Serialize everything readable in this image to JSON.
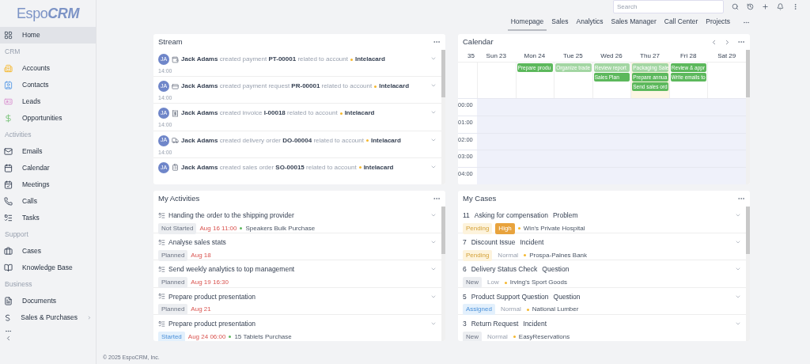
{
  "sidebar": {
    "logo": {
      "part_1": "Espo",
      "part_2": "CRM"
    },
    "groups": [
      {
        "items": [
          {
            "label": "Home",
            "selected": true,
            "expandable": false
          }
        ]
      },
      {
        "label": "CRM",
        "items": [
          {
            "label": "Accounts",
            "selected": false,
            "expandable": false
          },
          {
            "label": "Contacts",
            "selected": false,
            "expandable": false
          },
          {
            "label": "Leads",
            "selected": false,
            "expandable": false
          },
          {
            "label": "Opportunities",
            "selected": false,
            "expandable": false
          }
        ]
      },
      {
        "label": "Activities",
        "items": [
          {
            "label": "Emails",
            "selected": false,
            "expandable": false
          },
          {
            "label": "Calendar",
            "selected": false,
            "expandable": false
          },
          {
            "label": "Meetings",
            "selected": false,
            "expandable": false
          },
          {
            "label": "Calls",
            "selected": false,
            "expandable": false
          },
          {
            "label": "Tasks",
            "selected": false,
            "expandable": false
          }
        ]
      },
      {
        "label": "Support",
        "items": [
          {
            "label": "Cases",
            "selected": false,
            "expandable": false
          },
          {
            "label": "Knowledge Base",
            "selected": false,
            "expandable": false
          }
        ]
      },
      {
        "label": "Business",
        "items": [
          {
            "label": "Documents",
            "selected": false,
            "expandable": false
          },
          {
            "label": "Sales & Purchases",
            "selected": false,
            "expandable": true
          }
        ]
      }
    ]
  },
  "search": {
    "placeholder": "Search"
  },
  "dashboard_tabs": [
    {
      "label": "Homepage",
      "selected": true
    },
    {
      "label": "Sales",
      "selected": false
    },
    {
      "label": "Analytics",
      "selected": false
    },
    {
      "label": "Sales Manager",
      "selected": false
    },
    {
      "label": "Call Center",
      "selected": false
    },
    {
      "label": "Projects",
      "selected": false
    }
  ],
  "stream": {
    "title": "Stream",
    "items": [
      {
        "avatar": "JA",
        "text": "**Jack Adams** created payment **PT-00001** related to account",
        "account": {
          "label": "Intelacard",
          "color": "#f5b82e"
        },
        "time": "14:00"
      },
      {
        "avatar": "JA",
        "text": "**Jack Adams** created payment request **PR-00001** related to account",
        "account": {
          "label": "Intelacard",
          "color": "#f5b82e"
        },
        "time": "14:00"
      },
      {
        "avatar": "JA",
        "text": "**Jack Adams** created invoice **I-00018** related to account",
        "account": {
          "label": "Intelacard",
          "color": "#f5b82e"
        },
        "time": "14:00"
      },
      {
        "avatar": "JA",
        "text": "**Jack Adams** created delivery order **DO-00004** related to account",
        "account": {
          "label": "Intelacard",
          "color": "#f5b82e"
        },
        "time": "14:00"
      },
      {
        "avatar": "JA",
        "text": "**Jack Adams** created sales order **SO-00015** related to account",
        "account": {
          "label": "Intelacard",
          "color": "#f5b82e"
        }
      }
    ]
  },
  "calendar": {
    "title": "Calendar",
    "week_number": "35",
    "days": [
      {
        "label": "Sun 23",
        "today": false
      },
      {
        "label": "Mon 24",
        "today": false,
        "events": [
          {
            "title": "Prepare produ",
            "color": "#5cb85c"
          }
        ]
      },
      {
        "label": "Tue 25",
        "today": false,
        "events": [
          {
            "title": "Organize trade",
            "color": "#a3d6a3"
          }
        ]
      },
      {
        "label": "Wed 26",
        "today": false,
        "events": [
          {
            "title": "Review report",
            "color": "#a3d6a3"
          },
          {
            "title": "Sales Plan",
            "color": "#5cb85c"
          }
        ]
      },
      {
        "label": "Thu 27",
        "today": true,
        "events": [
          {
            "title": "Packaging Sale",
            "color": "#a3d6a3"
          },
          {
            "title": "Prepare annua",
            "color": "#5cb85c"
          },
          {
            "title": "Send sales ord",
            "color": "#5cb85c"
          }
        ]
      },
      {
        "label": "Fri 28",
        "today": false,
        "events": [
          {
            "title": "Review & appr",
            "color": "#5cb85c"
          },
          {
            "title": "Write emails to",
            "color": "#5cb85c"
          }
        ]
      },
      {
        "label": "Sat 29",
        "today": false
      }
    ],
    "times": [
      "00:00",
      "01:00",
      "02:00",
      "03:00",
      "04:00"
    ]
  },
  "my_activities": {
    "title": "My Activities",
    "items": [
      {
        "title": "Handing the order to the shipping provider",
        "status": {
          "label": "Not Started",
          "kind": "neutral"
        },
        "date": "Aug 16 11:00",
        "related": {
          "label": "Speakers Bulk Purchase",
          "color": "#5cb85c"
        }
      },
      {
        "title": "Analyse sales stats",
        "status": {
          "label": "Planned",
          "kind": "neutral"
        },
        "date": "Aug 18"
      },
      {
        "title": "Send weekly analytics to top management",
        "status": {
          "label": "Planned",
          "kind": "neutral"
        },
        "date": "Aug 19 16:30"
      },
      {
        "title": "Prepare product presentation",
        "status": {
          "label": "Planned",
          "kind": "neutral"
        },
        "date": "Aug 21"
      },
      {
        "title": "Prepare product presentation",
        "status": {
          "label": "Started",
          "kind": "info"
        },
        "date": "Aug 24 06:00",
        "related": {
          "label": "15 Tablets Purchase",
          "color": "#5cb85c"
        }
      }
    ]
  },
  "my_cases": {
    "title": "My Cases",
    "items": [
      {
        "number": "11",
        "name": "Asking for compensation",
        "type": "Problem",
        "status": {
          "label": "Pending",
          "kind": "warning"
        },
        "priority": {
          "label": "High",
          "kind": "strong"
        },
        "account": {
          "label": "Win's Private Hospital",
          "color": "#f5b82e"
        }
      },
      {
        "number": "7",
        "name": "Discount Issue",
        "type": "Incident",
        "status": {
          "label": "Pending",
          "kind": "warning"
        },
        "priority": {
          "label": "Normal",
          "kind": "plain"
        },
        "account": {
          "label": "Prospa-Palnes Bank",
          "color": "#f5b82e"
        }
      },
      {
        "number": "6",
        "name": "Delivery Status Check",
        "type": "Question",
        "status": {
          "label": "New",
          "kind": "neutral"
        },
        "priority": {
          "label": "Low",
          "kind": "plain"
        },
        "account": {
          "label": "Irving's Sport Goods",
          "color": "#f5b82e"
        }
      },
      {
        "number": "5",
        "name": "Product Support Question",
        "type": "Question",
        "status": {
          "label": "Assigned",
          "kind": "info"
        },
        "priority": {
          "label": "Normal",
          "kind": "plain"
        },
        "account": {
          "label": "National Lumber",
          "color": "#f5b82e"
        }
      },
      {
        "number": "3",
        "name": "Return Request",
        "type": "Incident",
        "status": {
          "label": "New",
          "kind": "neutral"
        },
        "priority": {
          "label": "Normal",
          "kind": "plain"
        },
        "account": {
          "label": "EasyReservations",
          "color": "#f5b82e"
        }
      }
    ]
  },
  "footer": "© 2025 EspoCRM, Inc."
}
